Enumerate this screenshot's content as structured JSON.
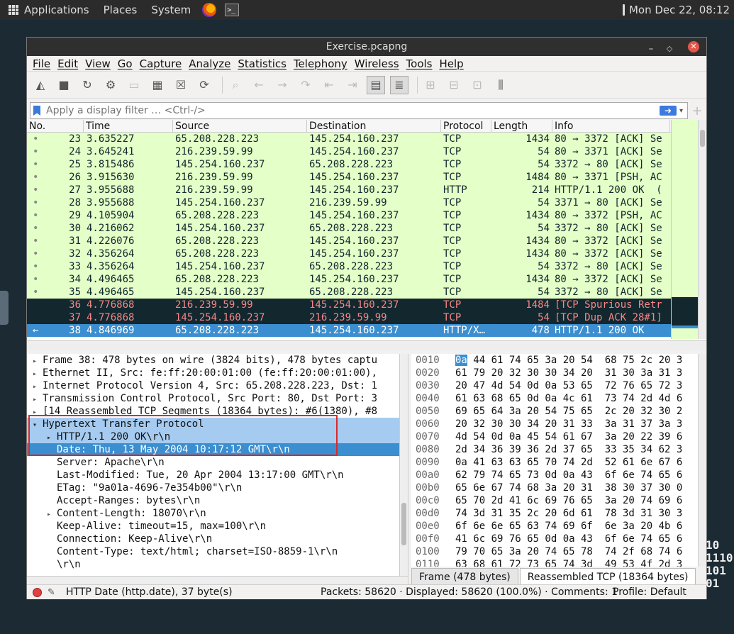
{
  "panel": {
    "applications": "Applications",
    "places": "Places",
    "system": "System",
    "clock": "Mon Dec 22, 08:12"
  },
  "window": {
    "title": "Exercise.pcapng"
  },
  "menu": [
    "File",
    "Edit",
    "View",
    "Go",
    "Capture",
    "Analyze",
    "Statistics",
    "Telephony",
    "Wireless",
    "Tools",
    "Help"
  ],
  "filter": {
    "placeholder": "Apply a display filter … <Ctrl-/>"
  },
  "packet_list": {
    "columns": [
      "No.",
      "Time",
      "Source",
      "Destination",
      "Protocol",
      "Length",
      "Info"
    ],
    "rows": [
      {
        "no": "23",
        "time": "3.635227",
        "src": "65.208.228.223",
        "dst": "145.254.160.237",
        "proto": "TCP",
        "len": "1434",
        "info": "80 → 3372 [ACK] Se",
        "style": "green"
      },
      {
        "no": "24",
        "time": "3.645241",
        "src": "216.239.59.99",
        "dst": "145.254.160.237",
        "proto": "TCP",
        "len": "54",
        "info": "80 → 3371 [ACK] Se",
        "style": "green"
      },
      {
        "no": "25",
        "time": "3.815486",
        "src": "145.254.160.237",
        "dst": "65.208.228.223",
        "proto": "TCP",
        "len": "54",
        "info": "3372 → 80 [ACK] Se",
        "style": "green"
      },
      {
        "no": "26",
        "time": "3.915630",
        "src": "216.239.59.99",
        "dst": "145.254.160.237",
        "proto": "TCP",
        "len": "1484",
        "info": "80 → 3371 [PSH, AC",
        "style": "green"
      },
      {
        "no": "27",
        "time": "3.955688",
        "src": "216.239.59.99",
        "dst": "145.254.160.237",
        "proto": "HTTP",
        "len": "214",
        "info": "HTTP/1.1 200 OK  (",
        "style": "green"
      },
      {
        "no": "28",
        "time": "3.955688",
        "src": "145.254.160.237",
        "dst": "216.239.59.99",
        "proto": "TCP",
        "len": "54",
        "info": "3371 → 80 [ACK] Se",
        "style": "green"
      },
      {
        "no": "29",
        "time": "4.105904",
        "src": "65.208.228.223",
        "dst": "145.254.160.237",
        "proto": "TCP",
        "len": "1434",
        "info": "80 → 3372 [PSH, AC",
        "style": "green"
      },
      {
        "no": "30",
        "time": "4.216062",
        "src": "145.254.160.237",
        "dst": "65.208.228.223",
        "proto": "TCP",
        "len": "54",
        "info": "3372 → 80 [ACK] Se",
        "style": "green"
      },
      {
        "no": "31",
        "time": "4.226076",
        "src": "65.208.228.223",
        "dst": "145.254.160.237",
        "proto": "TCP",
        "len": "1434",
        "info": "80 → 3372 [ACK] Se",
        "style": "green"
      },
      {
        "no": "32",
        "time": "4.356264",
        "src": "65.208.228.223",
        "dst": "145.254.160.237",
        "proto": "TCP",
        "len": "1434",
        "info": "80 → 3372 [ACK] Se",
        "style": "green"
      },
      {
        "no": "33",
        "time": "4.356264",
        "src": "145.254.160.237",
        "dst": "65.208.228.223",
        "proto": "TCP",
        "len": "54",
        "info": "3372 → 80 [ACK] Se",
        "style": "green"
      },
      {
        "no": "34",
        "time": "4.496465",
        "src": "65.208.228.223",
        "dst": "145.254.160.237",
        "proto": "TCP",
        "len": "1434",
        "info": "80 → 3372 [ACK] Se",
        "style": "green"
      },
      {
        "no": "35",
        "time": "4.496465",
        "src": "145.254.160.237",
        "dst": "65.208.228.223",
        "proto": "TCP",
        "len": "54",
        "info": "3372 → 80 [ACK] Se",
        "style": "green"
      },
      {
        "no": "36",
        "time": "4.776868",
        "src": "216.239.59.99",
        "dst": "145.254.160.237",
        "proto": "TCP",
        "len": "1484",
        "info": "[TCP Spurious Retr",
        "style": "dark"
      },
      {
        "no": "37",
        "time": "4.776868",
        "src": "145.254.160.237",
        "dst": "216.239.59.99",
        "proto": "TCP",
        "len": "54",
        "info": "[TCP Dup ACK 28#1]",
        "style": "dark"
      },
      {
        "no": "38",
        "time": "4.846969",
        "src": "65.208.228.223",
        "dst": "145.254.160.237",
        "proto": "HTTP/X…",
        "len": "478",
        "info": "HTTP/1.1 200 OK",
        "style": "sel"
      }
    ]
  },
  "details": [
    {
      "indent": 0,
      "arrow": "▸",
      "text": "Frame 38: 478 bytes on wire (3824 bits), 478 bytes captu",
      "style": ""
    },
    {
      "indent": 0,
      "arrow": "▸",
      "text": "Ethernet II, Src: fe:ff:20:00:01:00 (fe:ff:20:00:01:00),",
      "style": ""
    },
    {
      "indent": 0,
      "arrow": "▸",
      "text": "Internet Protocol Version 4, Src: 65.208.228.223, Dst: 1",
      "style": ""
    },
    {
      "indent": 0,
      "arrow": "▸",
      "text": "Transmission Control Protocol, Src Port: 80, Dst Port: 3",
      "style": ""
    },
    {
      "indent": 0,
      "arrow": "▸",
      "text": "[14 Reassembled TCP Segments (18364 bytes): #6(1380), #8",
      "style": ""
    },
    {
      "indent": 0,
      "arrow": "▾",
      "text": "Hypertext Transfer Protocol",
      "style": "sel-light"
    },
    {
      "indent": 1,
      "arrow": "▸",
      "text": "HTTP/1.1 200 OK\\r\\n",
      "style": "sel-light"
    },
    {
      "indent": 1,
      "arrow": "",
      "text": "Date: Thu, 13 May 2004 10:17:12 GMT\\r\\n",
      "style": "sel-dark"
    },
    {
      "indent": 1,
      "arrow": "",
      "text": "Server: Apache\\r\\n",
      "style": ""
    },
    {
      "indent": 1,
      "arrow": "",
      "text": "Last-Modified: Tue, 20 Apr 2004 13:17:00 GMT\\r\\n",
      "style": ""
    },
    {
      "indent": 1,
      "arrow": "",
      "text": "ETag: \"9a01a-4696-7e354b00\"\\r\\n",
      "style": ""
    },
    {
      "indent": 1,
      "arrow": "",
      "text": "Accept-Ranges: bytes\\r\\n",
      "style": ""
    },
    {
      "indent": 1,
      "arrow": "▸",
      "text": "Content-Length: 18070\\r\\n",
      "style": ""
    },
    {
      "indent": 1,
      "arrow": "",
      "text": "Keep-Alive: timeout=15, max=100\\r\\n",
      "style": ""
    },
    {
      "indent": 1,
      "arrow": "",
      "text": "Connection: Keep-Alive\\r\\n",
      "style": ""
    },
    {
      "indent": 1,
      "arrow": "",
      "text": "Content-Type: text/html; charset=ISO-8859-1\\r\\n",
      "style": ""
    },
    {
      "indent": 1,
      "arrow": "",
      "text": "\\r\\n",
      "style": ""
    }
  ],
  "hex": [
    {
      "off": "0010",
      "first": "0a",
      "rest": " 44 61 74 65 3a 20 54  68 75 2c 20 3"
    },
    {
      "off": "0020",
      "first": "",
      "rest": "61 79 20 32 30 30 34 20  31 30 3a 31 3"
    },
    {
      "off": "0030",
      "first": "",
      "rest": "20 47 4d 54 0d 0a 53 65  72 76 65 72 3"
    },
    {
      "off": "0040",
      "first": "",
      "rest": "61 63 68 65 0d 0a 4c 61  73 74 2d 4d 6"
    },
    {
      "off": "0050",
      "first": "",
      "rest": "69 65 64 3a 20 54 75 65  2c 20 32 30 2"
    },
    {
      "off": "0060",
      "first": "",
      "rest": "20 32 30 30 34 20 31 33  3a 31 37 3a 3"
    },
    {
      "off": "0070",
      "first": "",
      "rest": "4d 54 0d 0a 45 54 61 67  3a 20 22 39 6"
    },
    {
      "off": "0080",
      "first": "",
      "rest": "2d 34 36 39 36 2d 37 65  33 35 34 62 3"
    },
    {
      "off": "0090",
      "first": "",
      "rest": "0a 41 63 63 65 70 74 2d  52 61 6e 67 6"
    },
    {
      "off": "00a0",
      "first": "",
      "rest": "62 79 74 65 73 0d 0a 43  6f 6e 74 65 6"
    },
    {
      "off": "00b0",
      "first": "",
      "rest": "65 6e 67 74 68 3a 20 31  38 30 37 30 0"
    },
    {
      "off": "00c0",
      "first": "",
      "rest": "65 70 2d 41 6c 69 76 65  3a 20 74 69 6"
    },
    {
      "off": "00d0",
      "first": "",
      "rest": "74 3d 31 35 2c 20 6d 61  78 3d 31 30 3"
    },
    {
      "off": "00e0",
      "first": "",
      "rest": "6f 6e 6e 65 63 74 69 6f  6e 3a 20 4b 6"
    },
    {
      "off": "00f0",
      "first": "",
      "rest": "41 6c 69 76 65 0d 0a 43  6f 6e 74 65 6"
    },
    {
      "off": "0100",
      "first": "",
      "rest": "79 70 65 3a 20 74 65 78  74 2f 68 74 6"
    },
    {
      "off": "0110",
      "first": "",
      "rest": "63 68 61 72 73 65 74 3d  49 53 4f 2d 3"
    }
  ],
  "hex_tabs": [
    "Frame (478 bytes)",
    "Reassembled TCP (18364 bytes)"
  ],
  "status": {
    "field": "HTTP Date (http.date), 37 byte(s)",
    "packets": "Packets: 58620 · Displayed: 58620 (100.0%) · Comments: 1",
    "profile": "Profile: Default"
  },
  "decoration": "10\n1110\n101\n01"
}
